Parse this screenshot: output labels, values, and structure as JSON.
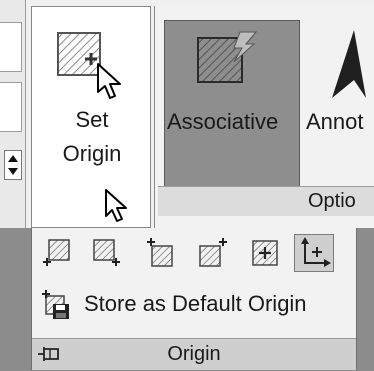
{
  "set_origin": {
    "label": "Set\nOrigin",
    "icon": "set-origin-icon"
  },
  "options": {
    "associative_label": "Associative",
    "annotate_label": "Annot",
    "group_title": "Optio"
  },
  "origin_panel": {
    "tools": [
      {
        "icon": "origin-tool-1-icon"
      },
      {
        "icon": "origin-tool-2-icon"
      },
      {
        "icon": "origin-tool-3-icon"
      },
      {
        "icon": "origin-tool-4-icon"
      },
      {
        "icon": "origin-tool-5-icon"
      },
      {
        "icon": "origin-axes-icon",
        "active": true
      }
    ],
    "store_default_label": "Store as Default Origin",
    "title": "Origin"
  }
}
